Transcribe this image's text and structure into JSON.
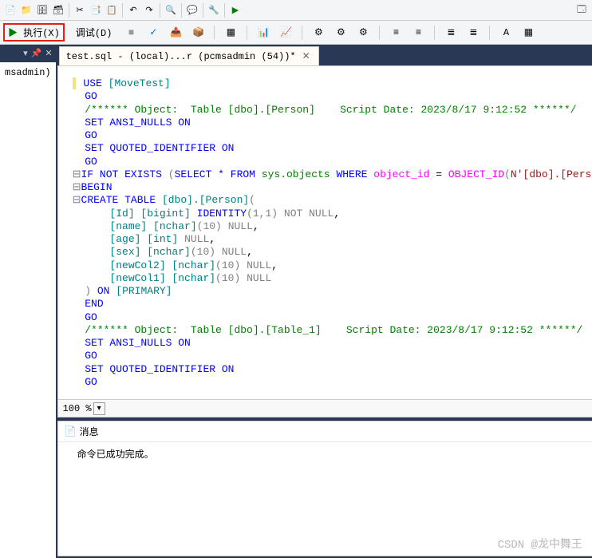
{
  "menu": {
    "execute": "执行(X)",
    "debug": "调试(D)"
  },
  "tab": {
    "title": "test.sql - (local)...r (pcmsadmin (54))*"
  },
  "sidebar": {
    "item": "msadmin)"
  },
  "zoom": {
    "level": "100 %"
  },
  "messages": {
    "header": "消息",
    "body": "命令已成功完成。"
  },
  "watermark": "CSDN @龙中舞王",
  "sql": {
    "l1_use": "USE",
    "l1_db": "[MoveTest]",
    "go": "GO",
    "cmt1_a": "/****** Object:  Table [dbo].[Person]    Script Date: 2023/8/17 9:12:52 ******/",
    "set_ansi": "SET ANSI_NULLS ON",
    "set_quoted": "SET QUOTED_IDENTIFIER ON",
    "if_not_exists": "IF NOT EXISTS",
    "select_from": "SELECT * FROM",
    "sys_objects": "sys.objects",
    "where": "WHERE",
    "object_id": "object_id",
    "eq": " = ",
    "fn_object_id": "OBJECT_ID",
    "n_str": "N'[dbo].[Perso",
    "begin": "BEGIN",
    "create_table": "CREATE TABLE",
    "dbo_person": "[dbo].[Person]",
    "paren_open": "(",
    "col_id": "    [Id] [bigint]",
    "identity": "IDENTITY",
    "identity_args": "(1,1)",
    "not_null": "NOT NULL",
    "col_name": "    [name] [nchar]",
    "ten": "(10)",
    "null": "NULL",
    "col_age": "    [age] [int]",
    "col_sex": "    [sex] [nchar]",
    "col_new2": "    [newCol2] [nchar]",
    "col_new1": "    [newCol1] [nchar]",
    "on_primary": ") ON [PRIMARY]",
    "end": "END",
    "cmt2_a": "/****** Object:  Table [dbo].[Table_1]    Script Date: 2023/8/17 9:12:52 ******/"
  }
}
